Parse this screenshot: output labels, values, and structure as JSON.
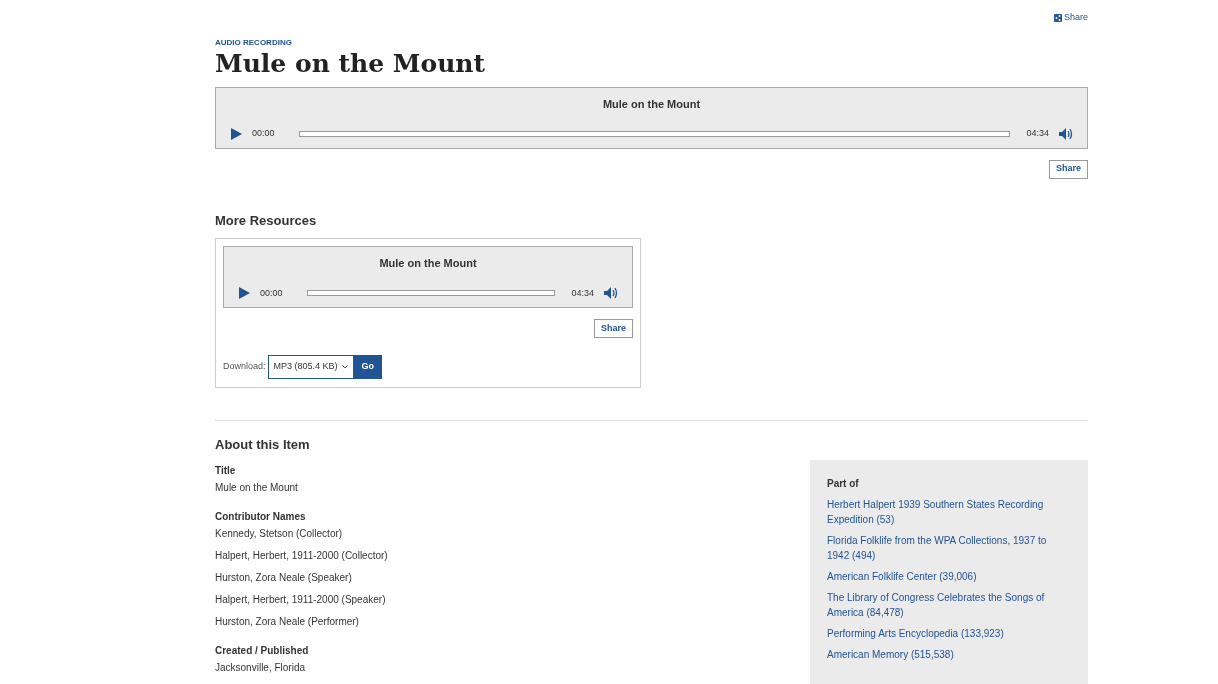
{
  "top_share": {
    "label": "Share"
  },
  "eyebrow": "AUDIO RECORDING",
  "title": "Mule on the Mount",
  "main_player": {
    "title": "Mule on the Mount",
    "elapsed": "00:00",
    "duration": "04:34",
    "level": 0,
    "share": "Share"
  },
  "more_resources": {
    "heading": "More Resources",
    "player": {
      "title": "Mule on the Mount",
      "elapsed": "00:00",
      "duration": "04:34",
      "level": 0,
      "share": "Share"
    },
    "download_label": "Download:",
    "download_value": "MP3 (805.4 KB)",
    "go": "Go"
  },
  "about": {
    "heading": "About this Item",
    "fields": [
      {
        "label": "Title",
        "values": [
          "Mule on the Mount"
        ]
      },
      {
        "label": "Contributor Names",
        "values": [
          "Kennedy, Stetson (Collector)",
          "Halpert, Herbert, 1911-2000 (Collector)",
          "Hurston, Zora Neale (Speaker)",
          "Halpert, Herbert, 1911-2000 (Speaker)",
          "Hurston, Zora Neale (Performer)"
        ]
      },
      {
        "label": "Created / Published",
        "values": [
          "Jacksonville, Florida"
        ]
      }
    ]
  },
  "part_of": {
    "heading": "Part of",
    "links": [
      "Herbert Halpert 1939 Southern States Recording Expedition (53)",
      "Florida Folklife from the WPA Collections, 1937 to 1942 (494)",
      "American Folklife Center (39,006)",
      "The Library of Congress Celebrates the Songs of America (84,478)",
      "Performing Arts Encyclopedia (133,923)",
      "American Memory (515,538)"
    ]
  }
}
